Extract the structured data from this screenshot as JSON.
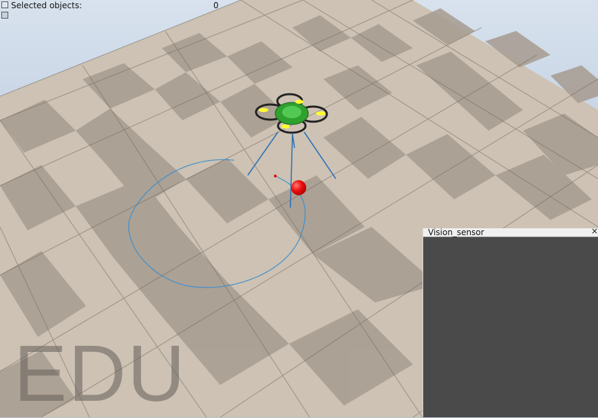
{
  "info_bar": {
    "label": "Selected objects:",
    "value": "0"
  },
  "vision_sensor": {
    "title": "Vision_sensor",
    "close_glyph": "×"
  },
  "watermark": {
    "text": "EDU"
  },
  "icons": [
    "toggle-info-icon",
    "display-options-icon",
    "close-icon"
  ],
  "colors": {
    "sky": "#b6c6dc",
    "floor_light": "#d3c8b9",
    "floor_dark": "#aa9f93",
    "path": "#3a8fd0",
    "target": "#e00000",
    "drone_body": "#2ea12e",
    "sensor_bg": "#4a4a4a"
  }
}
